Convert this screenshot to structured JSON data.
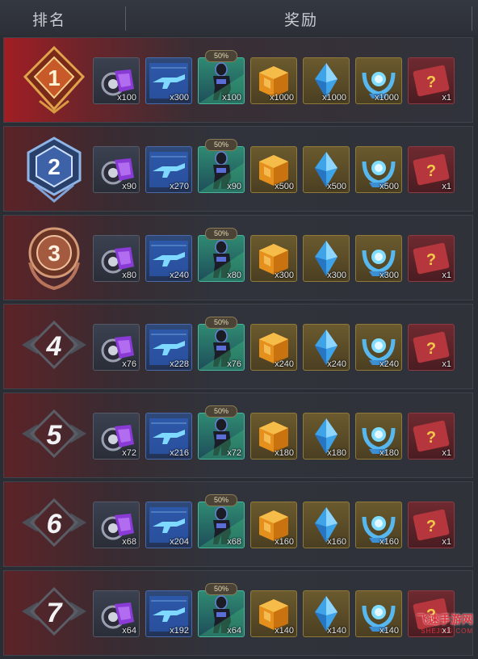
{
  "header": {
    "rank_label": "排名",
    "reward_label": "奖励"
  },
  "rows": [
    {
      "rank": "1",
      "percent": "50%",
      "qty": [
        "x100",
        "x300",
        "x100",
        "x1000",
        "x1000",
        "x1000",
        "x1"
      ]
    },
    {
      "rank": "2",
      "percent": "50%",
      "qty": [
        "x90",
        "x270",
        "x90",
        "x500",
        "x500",
        "x500",
        "x1"
      ]
    },
    {
      "rank": "3",
      "percent": "50%",
      "qty": [
        "x80",
        "x240",
        "x80",
        "x300",
        "x300",
        "x300",
        "x1"
      ]
    },
    {
      "rank": "4",
      "percent": "50%",
      "qty": [
        "x76",
        "x228",
        "x76",
        "x240",
        "x240",
        "x240",
        "x1"
      ]
    },
    {
      "rank": "5",
      "percent": "50%",
      "qty": [
        "x72",
        "x216",
        "x72",
        "x180",
        "x180",
        "x180",
        "x1"
      ]
    },
    {
      "rank": "6",
      "percent": "50%",
      "qty": [
        "x68",
        "x204",
        "x68",
        "x160",
        "x160",
        "x160",
        "x1"
      ]
    },
    {
      "rank": "7",
      "percent": "50%",
      "qty": [
        "x64",
        "x192",
        "x64",
        "x140",
        "x140",
        "x140",
        "x1"
      ]
    }
  ],
  "item_icons": [
    "purple-gadget-icon",
    "weapon-blueprint-card-icon",
    "soldier-character-icon",
    "orange-crate-icon",
    "blue-crystal-icon",
    "blue-emblem-icon",
    "mystery-question-card-icon"
  ],
  "colors": {
    "top_row_accent": "#a11e24",
    "row_accent": "#5c2327",
    "background": "#2a2d34"
  },
  "watermark": {
    "line1": "飞速手游网",
    "line2": "SHEJIJG.COM"
  }
}
